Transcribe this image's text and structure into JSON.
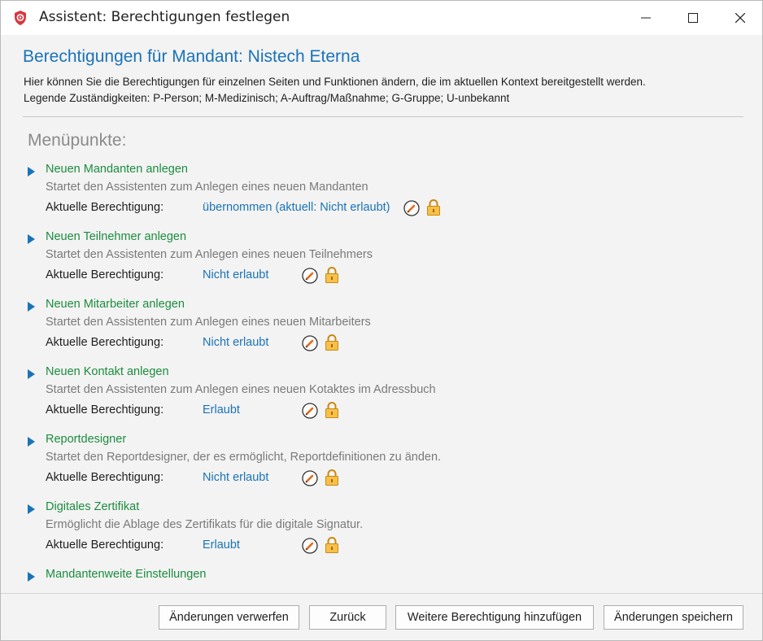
{
  "window": {
    "title": "Assistent: Berechtigungen festlegen",
    "icon": "shield-icon",
    "controls": [
      "minimize-icon",
      "maximize-icon",
      "close-icon"
    ]
  },
  "header": {
    "title": "Berechtigungen für Mandant: Nistech Eterna",
    "description_line1": "Hier können Sie die Berechtigungen für einzelnen Seiten und Funktionen ändern, die im aktuellen Kontext bereitgestellt werden.",
    "description_line2": "Legende Zuständigkeiten: P-Person; M-Medizinisch; A-Auftrag/Maßnahme; G-Gruppe; U-unbekannt"
  },
  "menu": {
    "section_title": "Menüpunkte:",
    "permission_label": "Aktuelle Berechtigung:",
    "items": [
      {
        "title": "Neuen Mandanten anlegen",
        "description": "Startet den Assistenten zum Anlegen eines neuen Mandanten",
        "permission": "übernommen (aktuell: Nicht erlaubt)"
      },
      {
        "title": "Neuen Teilnehmer anlegen",
        "description": "Startet den Assistenten zum Anlegen eines neuen Teilnehmers",
        "permission": "Nicht erlaubt"
      },
      {
        "title": "Neuen Mitarbeiter anlegen",
        "description": "Startet den Assistenten zum Anlegen eines neuen Mitarbeiters",
        "permission": "Nicht erlaubt"
      },
      {
        "title": "Neuen Kontakt anlegen",
        "description": "Startet den Assistenten zum Anlegen eines neuen Kotaktes im Adressbuch",
        "permission": "Erlaubt"
      },
      {
        "title": "Reportdesigner",
        "description": "Startet den Reportdesigner, der es ermöglicht, Reportdefinitionen zu änden.",
        "permission": "Nicht erlaubt"
      },
      {
        "title": "Digitales Zertifikat",
        "description": "Ermöglicht die Ablage des Zertifikats für die digitale Signatur.",
        "permission": "Erlaubt"
      },
      {
        "title": "Mandantenweite Einstellungen"
      }
    ]
  },
  "footer": {
    "discard_label": "Änderungen verwerfen",
    "back_label": "Zurück",
    "add_permission_label": "Weitere Berechtigung hinzufügen",
    "save_label": "Änderungen speichern"
  },
  "colors": {
    "accent": "#1a73b8",
    "item_title": "#1b8c3e",
    "muted": "#7a7a7a",
    "lock": "#f2a51f"
  }
}
